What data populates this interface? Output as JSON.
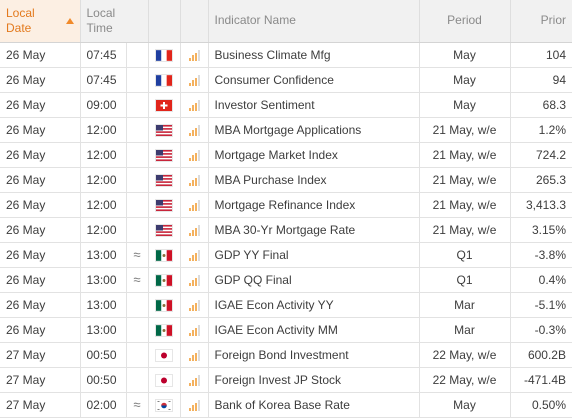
{
  "header": {
    "local_date": "Local\nDate",
    "local_time": "Local\nTime",
    "indicator_name": "Indicator Name",
    "period": "Period",
    "prior": "Prior"
  },
  "colors": {
    "sorted_header_bg": "#fcefe3",
    "sorted_header_text": "#e37a1e",
    "importance_bar": "#f4b15e"
  },
  "rows": [
    {
      "date": "26 May",
      "time": "07:45",
      "approx": "",
      "flag": "fr-flag-icon",
      "importance": 3,
      "name": "Business Climate Mfg",
      "period": "May",
      "prior": "104"
    },
    {
      "date": "26 May",
      "time": "07:45",
      "approx": "",
      "flag": "fr-flag-icon",
      "importance": 3,
      "name": "Consumer Confidence",
      "period": "May",
      "prior": "94"
    },
    {
      "date": "26 May",
      "time": "09:00",
      "approx": "",
      "flag": "ch-flag-icon",
      "importance": 3,
      "name": "Investor Sentiment",
      "period": "May",
      "prior": "68.3"
    },
    {
      "date": "26 May",
      "time": "12:00",
      "approx": "",
      "flag": "us-flag-icon",
      "importance": 3,
      "name": "MBA Mortgage Applications",
      "period": "21 May, w/e",
      "prior": "1.2%"
    },
    {
      "date": "26 May",
      "time": "12:00",
      "approx": "",
      "flag": "us-flag-icon",
      "importance": 3,
      "name": "Mortgage Market Index",
      "period": "21 May, w/e",
      "prior": "724.2"
    },
    {
      "date": "26 May",
      "time": "12:00",
      "approx": "",
      "flag": "us-flag-icon",
      "importance": 3,
      "name": "MBA Purchase Index",
      "period": "21 May, w/e",
      "prior": "265.3"
    },
    {
      "date": "26 May",
      "time": "12:00",
      "approx": "",
      "flag": "us-flag-icon",
      "importance": 3,
      "name": "Mortgage Refinance Index",
      "period": "21 May, w/e",
      "prior": "3,413.3"
    },
    {
      "date": "26 May",
      "time": "12:00",
      "approx": "",
      "flag": "us-flag-icon",
      "importance": 3,
      "name": "MBA 30-Yr Mortgage Rate",
      "period": "21 May, w/e",
      "prior": "3.15%"
    },
    {
      "date": "26 May",
      "time": "13:00",
      "approx": "≈",
      "flag": "mx-flag-icon",
      "importance": 3,
      "name": "GDP YY Final",
      "period": "Q1",
      "prior": "-3.8%"
    },
    {
      "date": "26 May",
      "time": "13:00",
      "approx": "≈",
      "flag": "mx-flag-icon",
      "importance": 3,
      "name": "GDP QQ Final",
      "period": "Q1",
      "prior": "0.4%"
    },
    {
      "date": "26 May",
      "time": "13:00",
      "approx": "",
      "flag": "mx-flag-icon",
      "importance": 3,
      "name": "IGAE Econ Activity YY",
      "period": "Mar",
      "prior": "-5.1%"
    },
    {
      "date": "26 May",
      "time": "13:00",
      "approx": "",
      "flag": "mx-flag-icon",
      "importance": 3,
      "name": "IGAE Econ Activity MM",
      "period": "Mar",
      "prior": "-0.3%"
    },
    {
      "date": "27 May",
      "time": "00:50",
      "approx": "",
      "flag": "jp-flag-icon",
      "importance": 3,
      "name": "Foreign Bond Investment",
      "period": "22 May, w/e",
      "prior": "600.2B"
    },
    {
      "date": "27 May",
      "time": "00:50",
      "approx": "",
      "flag": "jp-flag-icon",
      "importance": 3,
      "name": "Foreign Invest JP Stock",
      "period": "22 May, w/e",
      "prior": "-471.4B"
    },
    {
      "date": "27 May",
      "time": "02:00",
      "approx": "≈",
      "flag": "kr-flag-icon",
      "importance": 3,
      "name": "Bank of Korea Base Rate",
      "period": "May",
      "prior": "0.50%"
    }
  ]
}
